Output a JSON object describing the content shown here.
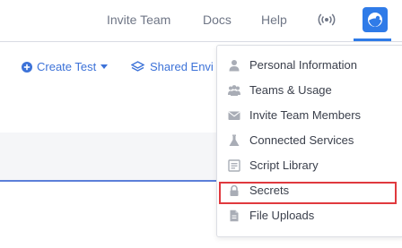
{
  "header": {
    "nav": [
      "Invite Team",
      "Docs",
      "Help"
    ],
    "broadcast_icon": "broadcast-icon",
    "avatar_icon": "user-avatar-icon"
  },
  "toolbar": {
    "create_test": "Create Test",
    "shared_env": "Shared Envi"
  },
  "menu": {
    "items": [
      {
        "label": "Personal Information",
        "icon": "person-icon"
      },
      {
        "label": "Teams & Usage",
        "icon": "team-icon"
      },
      {
        "label": "Invite Team Members",
        "icon": "envelope-icon"
      },
      {
        "label": "Connected Services",
        "icon": "flask-icon"
      },
      {
        "label": "Script Library",
        "icon": "script-icon"
      },
      {
        "label": "Secrets",
        "icon": "lock-icon",
        "highlighted": true
      },
      {
        "label": "File Uploads",
        "icon": "file-icon"
      }
    ]
  },
  "colors": {
    "accent": "#2f7be8",
    "link": "#3c72d8",
    "highlight": "#e0393e",
    "icon": "#a9adb6"
  }
}
